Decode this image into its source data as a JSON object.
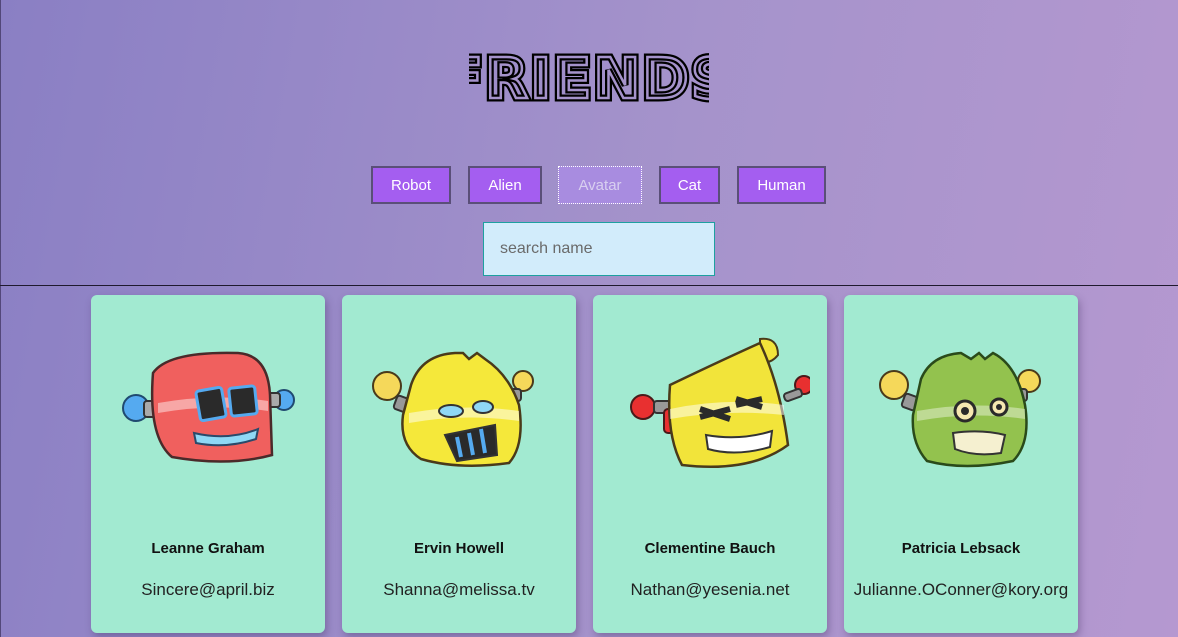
{
  "header": {
    "title": "FRIENDS"
  },
  "filters": [
    {
      "label": "Robot",
      "active": false
    },
    {
      "label": "Alien",
      "active": false
    },
    {
      "label": "Avatar",
      "active": true
    },
    {
      "label": "Cat",
      "active": false
    },
    {
      "label": "Human",
      "active": false
    }
  ],
  "search": {
    "placeholder": "search name",
    "value": ""
  },
  "cards": [
    {
      "name": "Leanne Graham",
      "email": "Sincere@april.biz",
      "avatar_icon": "robot-avatar-icon",
      "color": "#f0605e"
    },
    {
      "name": "Ervin Howell",
      "email": "Shanna@melissa.tv",
      "avatar_icon": "robot-avatar-icon",
      "color": "#f5e83a"
    },
    {
      "name": "Clementine Bauch",
      "email": "Nathan@yesenia.net",
      "avatar_icon": "robot-avatar-icon",
      "color": "#f2e43a"
    },
    {
      "name": "Patricia Lebsack",
      "email": "Julianne.OConner@kory.org",
      "avatar_icon": "robot-avatar-icon",
      "color": "#93c24e"
    }
  ],
  "colors": {
    "button": "#a45ef0",
    "card": "#a2ead1",
    "search_bg": "#d2ecfb"
  }
}
